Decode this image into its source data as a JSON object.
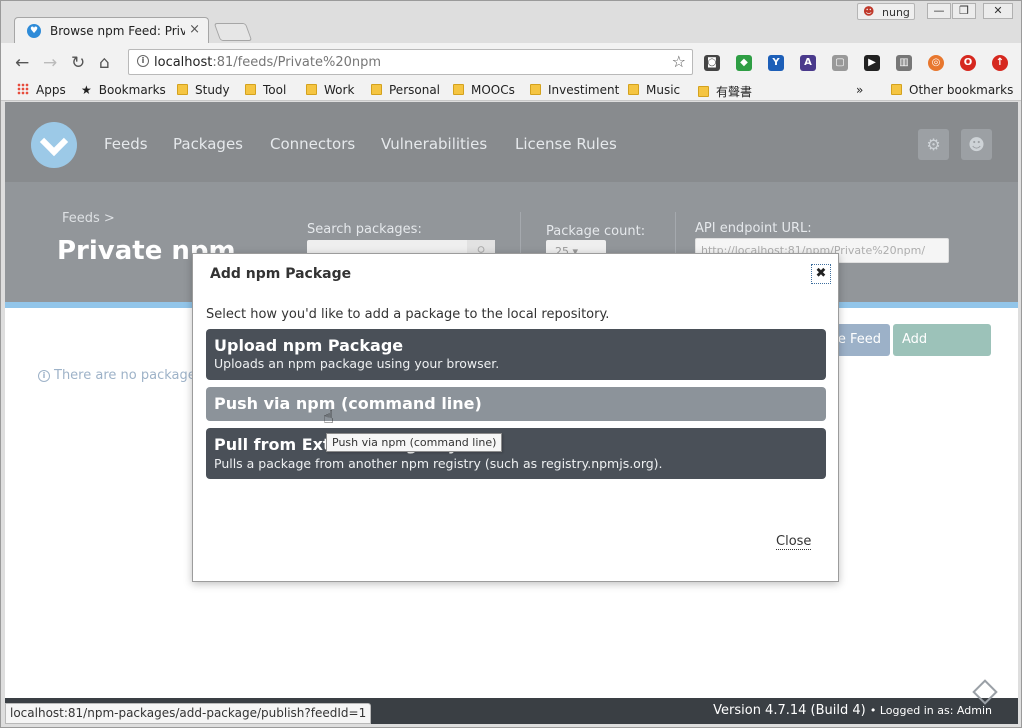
{
  "browser": {
    "tab_title": "Browse npm Feed: Private",
    "profile_name": "nung",
    "url_host": "localhost",
    "url_rest": ":81/feeds/Private%20npm",
    "bookmarks": [
      {
        "label": "Apps",
        "icon": "apps-grid-icon"
      },
      {
        "label": "Bookmarks",
        "icon": "star-icon"
      },
      {
        "label": "Study",
        "icon": "folder-icon"
      },
      {
        "label": "Tool",
        "icon": "folder-icon"
      },
      {
        "label": "Work",
        "icon": "folder-icon"
      },
      {
        "label": "Personal",
        "icon": "folder-icon"
      },
      {
        "label": "MOOCs",
        "icon": "folder-icon"
      },
      {
        "label": "Investiment",
        "icon": "folder-icon"
      },
      {
        "label": "Music",
        "icon": "folder-icon"
      },
      {
        "label": "有聲書",
        "icon": "folder-icon"
      }
    ],
    "other_bookmarks": "Other bookmarks",
    "overflow": "»",
    "status_url": "localhost:81/npm-packages/add-package/publish?feedId=1"
  },
  "nav": {
    "items": [
      "Feeds",
      "Packages",
      "Connectors",
      "Vulnerabilities",
      "License Rules"
    ]
  },
  "header": {
    "breadcrumb": "Feeds >",
    "title": "Private npm",
    "search_label": "Search packages:",
    "count_label": "Package count:",
    "count_value": "25",
    "api_label": "API endpoint URL:",
    "api_value": "http://localhost:81/npm/Private%20npm/"
  },
  "actions": {
    "manage_feed": "Manage Feed",
    "add_package": "Add Package"
  },
  "empty_message": "There are no packages in this feed.",
  "modal": {
    "title": "Add npm Package",
    "description": "Select how you'd like to add a package to the local repository.",
    "options": [
      {
        "title": "Upload npm Package",
        "description": "Uploads an npm package using your browser."
      },
      {
        "title": "Push via npm (command line)",
        "description": ""
      },
      {
        "title": "Pull from External Registry",
        "description": "Pulls a package from another npm registry (such as registry.npmjs.org)."
      }
    ],
    "close_label": "Close"
  },
  "tooltip": "Push via npm (command line)",
  "footer": {
    "version": "Version 4.7.14 (Build 4)",
    "logged_in": "• Logged in as: Admin"
  },
  "colors": {
    "nav_bg": "#3a3f44",
    "header_bg": "#4a5058",
    "accent_blue": "#4a9edb",
    "add_package_btn": "#5b9a8b",
    "manage_feed_btn": "#5a7ea4"
  }
}
